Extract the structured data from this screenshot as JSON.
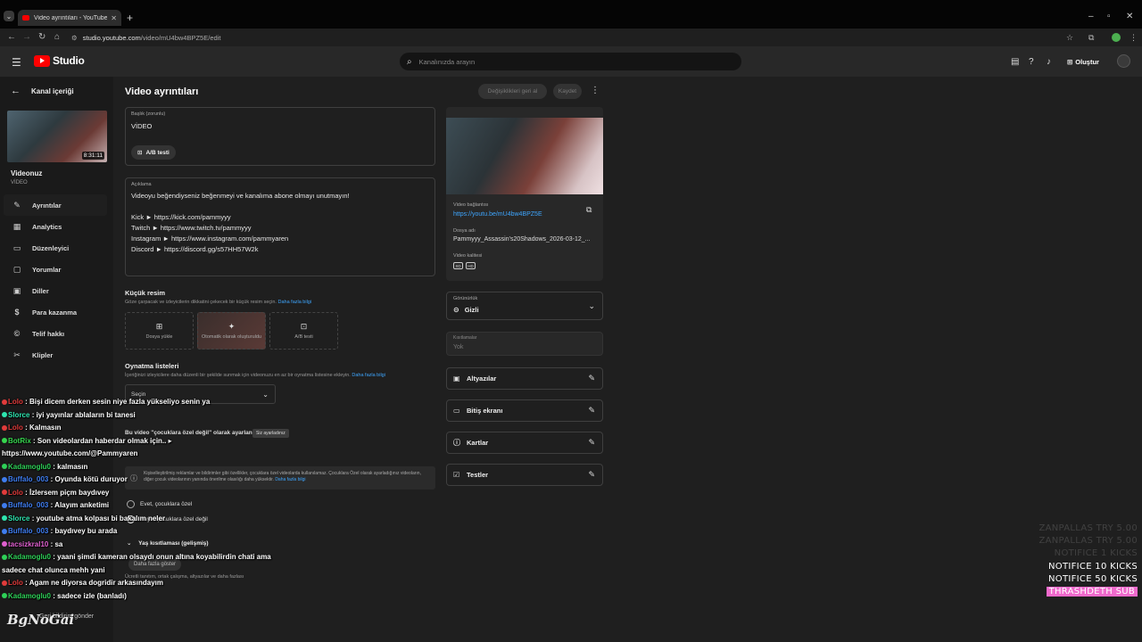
{
  "browser": {
    "tab_title": "Video ayrıntıları - YouTube Studio",
    "url_host": "studio.youtube.com",
    "url_path": "/video/mU4bw4BPZ5E/edit"
  },
  "header": {
    "logo_text": "Studio",
    "search_placeholder": "Kanalınızda arayın",
    "create_label": "Oluştur"
  },
  "sidebar": {
    "back_label": "Kanal içeriği",
    "thumb_duration": "8:31:11",
    "video_title": "Videonuz",
    "video_subtitle": "VİDEO",
    "items": [
      {
        "label": "Ayrıntılar",
        "icon": "pencil-icon"
      },
      {
        "label": "Analytics",
        "icon": "analytics-icon"
      },
      {
        "label": "Düzenleyici",
        "icon": "editor-icon"
      },
      {
        "label": "Yorumlar",
        "icon": "comments-icon"
      },
      {
        "label": "Diller",
        "icon": "subtitles-icon"
      },
      {
        "label": "Para kazanma",
        "icon": "dollar-icon"
      },
      {
        "label": "Telif hakkı",
        "icon": "copyright-icon"
      },
      {
        "label": "Klipler",
        "icon": "scissors-icon"
      }
    ],
    "feedback_label": "Geri bildirim gönder"
  },
  "main": {
    "page_title": "Video ayrıntıları",
    "undo_label": "Değişiklikleri geri al",
    "save_label": "Kaydet",
    "title_field": {
      "label": "Başlık (zorunlu)",
      "value": "VİDEO",
      "ab_label": "A/B testi"
    },
    "description": {
      "label": "Açıklama",
      "lines": [
        "Videoyu beğendiyseniz beğenmeyi ve kanalıma abone olmayı unutmayın!",
        "",
        "Kick ► https://kick.com/pammyyy",
        "Twitch ► https://www.twitch.tv/pammyyy",
        "Instagram ► https://www.instagram.com/pammyaren",
        "Discord ► https://discord.gg/s57HH57W2k"
      ]
    },
    "thumbnail": {
      "title": "Küçük resim",
      "subtitle": "Göze çarpacak ve izleyicilerin dikkatini çekecek bir küçük resim seçin.",
      "link": "Daha fazla bilgi",
      "options": [
        "Dosya yükle",
        "Otomatik olarak oluşturuldu",
        "A/B testi"
      ]
    },
    "playlists": {
      "title": "Oynatma listeleri",
      "subtitle": "İçeriğinizi izleyicilere daha düzenli bir şekilde sunmak için videonuzu en az bir oynatma listesine ekleyin.",
      "link": "Daha fazla bilgi",
      "select_value": "Seçin"
    },
    "audience": {
      "label": "Bu video \"çocuklara özel değil\" olarak ayarlandı",
      "chip": "Siz ayarladınız",
      "info": "Kişiselleştirilmiş reklamlar ve bildirimler gibi özellikler, çocuklara özel videolarda kullanılamaz. Çocuklara Özel olarak ayarladığınız videoların, diğer çocuk videolarının yanında önerilme olasılığı daha yüksektir.",
      "info_link": "Daha fazla bilgi",
      "options": [
        "Evet, çocuklara özel",
        "Hayır, çocuklara özel değil"
      ]
    },
    "age_restriction": "Yaş kısıtlaması (gelişmiş)",
    "show_more": "Daha fazla göster",
    "more_subtitle": "Ücretli tanıtım, ortak çalışma, altyazılar ve daha fazlası"
  },
  "right_panel": {
    "video_link_label": "Video bağlantısı",
    "video_link": "https://youtu.be/mU4bw4BPZ5E",
    "file_label": "Dosya adı",
    "file_name": "Pammyyy_Assassin's20Shadows_2026-03-12_...",
    "quality_label": "Video kalitesi",
    "quality_badges": [
      "SD",
      "HD"
    ],
    "visibility_label": "Görünürlük",
    "visibility_value": "Gizli",
    "restrictions_label": "Kısıtlamalar",
    "restrictions_value": "Yok",
    "tools": [
      "Altyazılar",
      "Bitiş ekranı",
      "Kartlar",
      "Testler"
    ]
  },
  "chat": [
    {
      "user": "Lolo",
      "msg": "Bişi dicem derken sesin niye fazla yükseliyo senin ya",
      "color": "#e23b3b"
    },
    {
      "user": "Slorce",
      "msg": "iyi yayınlar ablaların bi tanesi",
      "color": "#2ee6b0"
    },
    {
      "user": "Lolo",
      "msg": "Kalmasın",
      "color": "#e23b3b"
    },
    {
      "user": "BotRix",
      "msg": "Son videolardan haberdar olmak için.. ▸",
      "color": "#36d64e"
    },
    {
      "user": "",
      "msg": "https://www.youtube.com/@Pammyaren",
      "color": "#ffffff"
    },
    {
      "user": "Kadamoglu0",
      "msg": "kalmasın",
      "color": "#2ed158"
    },
    {
      "user": "Buffalo_003",
      "msg": "Oyunda kötü duruyor",
      "color": "#3f7df0"
    },
    {
      "user": "Lolo",
      "msg": "İzlersem piçm baydıvey",
      "color": "#e23b3b"
    },
    {
      "user": "Buffalo_003",
      "msg": "Alayım anketimi",
      "color": "#3f7df0"
    },
    {
      "user": "Slorce",
      "msg": "youtube atma kolpası bi bakalım neler",
      "color": "#2ee6b0"
    },
    {
      "user": "Buffalo_003",
      "msg": "baydıvey bu arada",
      "color": "#3f7df0"
    },
    {
      "user": "tacsizkral10",
      "msg": "sa",
      "color": "#e060d0"
    },
    {
      "user": "Kadamoglu0",
      "msg": "yaani şimdi kameran olsaydı onun altına koyabilirdin chati ama",
      "color": "#2ed158"
    },
    {
      "user": "",
      "msg": "sadece chat olunca mehh yani",
      "color": "#ffffff"
    },
    {
      "user": "Lolo",
      "msg": "Agam ne diyorsa dogridir arkasındayım",
      "color": "#e23b3b"
    },
    {
      "user": "Kadamoglu0",
      "msg": "sadece izle (banladı)",
      "color": "#2ed158"
    }
  ],
  "alerts": [
    {
      "text": "ZANPALLAS TRY 5.00",
      "style": "dim"
    },
    {
      "text": "ZANPALLAS TRY 5.00",
      "style": "dim"
    },
    {
      "text": "NOTIFICE 1 KICKS",
      "style": "dim"
    },
    {
      "text": "NOTIFICE 10 KICKS",
      "style": "bright"
    },
    {
      "text": "NOTIFICE 50 KICKS",
      "style": "bright"
    },
    {
      "text": "THRASHDETH SUB",
      "style": "sub"
    }
  ],
  "watermark": "BgNoGai",
  "colors": {
    "accent": "#3ea6ff",
    "brand_red": "#ff0000",
    "sub_alert": "#f06acc"
  }
}
